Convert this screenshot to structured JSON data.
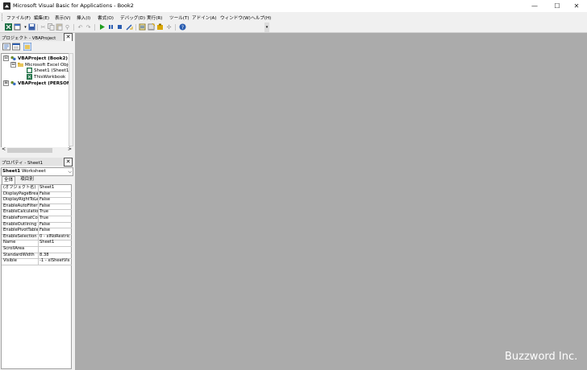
{
  "window": {
    "title": "Microsoft Visual Basic for Applications - Book2",
    "minimize_glyph": "—",
    "maximize_glyph": "☐",
    "close_glyph": "✕"
  },
  "menu": [
    {
      "label": "ファイル(F)"
    },
    {
      "label": "編集(E)"
    },
    {
      "label": "表示(V)"
    },
    {
      "label": "挿入(I)"
    },
    {
      "label": "書式(O)"
    },
    {
      "label": "デバッグ(D)"
    },
    {
      "label": "実行(R)"
    },
    {
      "label": "ツール(T)"
    },
    {
      "label": "アドイン(A)"
    },
    {
      "label": "ウィンドウ(W)"
    },
    {
      "label": "ヘルプ(H)"
    }
  ],
  "toolbar": {
    "icons": [
      "excel-view-icon",
      "insert-module-icon",
      "save-icon",
      "cut-icon",
      "copy-icon",
      "paste-icon",
      "find-icon",
      "undo-icon",
      "redo-icon",
      "run-icon",
      "break-icon",
      "reset-icon",
      "design-mode-icon",
      "project-explorer-icon",
      "properties-icon",
      "object-browser-icon",
      "toolbox-icon",
      "help-icon"
    ],
    "overflow_glyph": "▾"
  },
  "project_pane": {
    "title": "プロジェクト - VBAProject",
    "close_glyph": "✕",
    "tree": [
      {
        "label": "VBAProject (Book2)",
        "bold": true,
        "expander": "⊟"
      },
      {
        "label": "Microsoft Excel Objec",
        "bold": false,
        "expander": "⊟"
      },
      {
        "label": "Sheet1 (Sheet1)",
        "bold": false
      },
      {
        "label": "ThisWorkbook",
        "bold": false
      },
      {
        "label": "VBAProject (PERSON",
        "bold": true,
        "expander": "⊞"
      }
    ],
    "scroll_left": "<",
    "scroll_right": ">"
  },
  "properties_pane": {
    "title": "プロパティ - Sheet1",
    "close_glyph": "✕",
    "object_name": "Sheet1",
    "object_type": "Worksheet",
    "dropdown_glyph": "⌵",
    "tabs": [
      "全体",
      "項目別"
    ],
    "rows": [
      {
        "name": "(オブジェクト名)",
        "value": "Sheet1"
      },
      {
        "name": "DisplayPageBrea",
        "value": "False"
      },
      {
        "name": "DisplayRightToLe",
        "value": "False"
      },
      {
        "name": "EnableAutoFilter",
        "value": "False"
      },
      {
        "name": "EnableCalculatio",
        "value": "True"
      },
      {
        "name": "EnableFormatCo",
        "value": "True"
      },
      {
        "name": "EnableOutlining",
        "value": "False"
      },
      {
        "name": "EnablePivotTable",
        "value": "False"
      },
      {
        "name": "EnableSelection",
        "value": "0 - xlNoRestric"
      },
      {
        "name": "Name",
        "value": "Sheet1"
      },
      {
        "name": "ScrollArea",
        "value": ""
      },
      {
        "name": "StandardWidth",
        "value": "8.38"
      },
      {
        "name": "Visible",
        "value": "-1 - xlSheetVis"
      }
    ]
  },
  "watermark": "Buzzword Inc.",
  "colors": {
    "mdi_background": "#ababab",
    "titlebar": "#ffffff",
    "chrome": "#f0f0f0"
  }
}
